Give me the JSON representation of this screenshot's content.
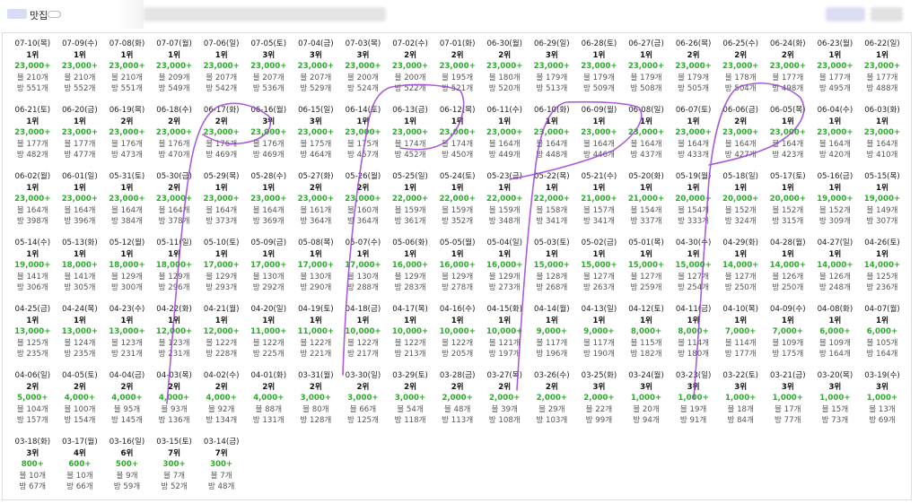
{
  "header": {
    "title": "맛집"
  },
  "rows": [
    [
      {
        "date": "07-10(목)",
        "rank": "1위",
        "price": "23,000+",
        "posts": "블 210개",
        "views": "방 551개"
      },
      {
        "date": "07-09(수)",
        "rank": "1위",
        "price": "23,000+",
        "posts": "블 210개",
        "views": "방 552개"
      },
      {
        "date": "07-08(화)",
        "rank": "1위",
        "price": "23,000+",
        "posts": "블 210개",
        "views": "방 551개"
      },
      {
        "date": "07-07(월)",
        "rank": "1위",
        "price": "23,000+",
        "posts": "블 209개",
        "views": "방 549개"
      },
      {
        "date": "07-06(일)",
        "rank": "1위",
        "price": "23,000+",
        "posts": "블 207개",
        "views": "방 542개"
      },
      {
        "date": "07-05(토)",
        "rank": "3위",
        "price": "23,000+",
        "posts": "블 207개",
        "views": "방 536개"
      },
      {
        "date": "07-04(금)",
        "rank": "3위",
        "price": "23,000+",
        "posts": "블 207개",
        "views": "방 529개"
      },
      {
        "date": "07-03(목)",
        "rank": "3위",
        "price": "23,000+",
        "posts": "블 200개",
        "views": "방 524개"
      },
      {
        "date": "07-02(수)",
        "rank": "2위",
        "price": "23,000+",
        "posts": "블 200개",
        "views": "방 522개"
      },
      {
        "date": "07-01(화)",
        "rank": "2위",
        "price": "23,000+",
        "posts": "블 195개",
        "views": "방 521개"
      },
      {
        "date": "06-30(월)",
        "rank": "2위",
        "price": "23,000+",
        "posts": "블 180개",
        "views": "방 520개"
      },
      {
        "date": "06-29(일)",
        "rank": "3위",
        "price": "23,000+",
        "posts": "블 179개",
        "views": "방 513개"
      },
      {
        "date": "06-28(토)",
        "rank": "1위",
        "price": "23,000+",
        "posts": "블 179개",
        "views": "방 509개"
      },
      {
        "date": "06-27(금)",
        "rank": "1위",
        "price": "23,000+",
        "posts": "블 179개",
        "views": "방 508개"
      },
      {
        "date": "06-26(목)",
        "rank": "2위",
        "price": "23,000+",
        "posts": "블 179개",
        "views": "방 505개"
      },
      {
        "date": "06-25(수)",
        "rank": "2위",
        "price": "23,000+",
        "posts": "블 178개",
        "views": "방 504개"
      },
      {
        "date": "06-24(화)",
        "rank": "2위",
        "price": "23,000+",
        "posts": "블 177개",
        "views": "방 498개"
      },
      {
        "date": "06-23(월)",
        "rank": "1위",
        "price": "23,000+",
        "posts": "블 177개",
        "views": "방 495개"
      },
      {
        "date": "06-22(일)",
        "rank": "1위",
        "price": "23,000+",
        "posts": "블 177개",
        "views": "방 488개"
      }
    ],
    [
      {
        "date": "06-21(토)",
        "rank": "1위",
        "price": "23,000+",
        "posts": "블 177개",
        "views": "방 482개"
      },
      {
        "date": "06-20(금)",
        "rank": "1위",
        "price": "23,000+",
        "posts": "블 177개",
        "views": "방 477개"
      },
      {
        "date": "06-19(목)",
        "rank": "2위",
        "price": "23,000+",
        "posts": "블 176개",
        "views": "방 473개"
      },
      {
        "date": "06-18(수)",
        "rank": "2위",
        "price": "23,000+",
        "posts": "블 176개",
        "views": "방 470개"
      },
      {
        "date": "06-17(화)",
        "rank": "2위",
        "price": "23,000+",
        "posts": "블 176개",
        "views": "방 469개"
      },
      {
        "date": "06-16(월)",
        "rank": "3위",
        "price": "23,000+",
        "posts": "블 176개",
        "views": "방 469개"
      },
      {
        "date": "06-15(일)",
        "rank": "3위",
        "price": "23,000+",
        "posts": "블 175개",
        "views": "방 464개"
      },
      {
        "date": "06-14(토)",
        "rank": "1위",
        "price": "23,000+",
        "posts": "블 175개",
        "views": "방 457개"
      },
      {
        "date": "06-13(금)",
        "rank": "1위",
        "price": "23,000+",
        "posts": "블 174개",
        "views": "방 452개"
      },
      {
        "date": "06-12(목)",
        "rank": "1위",
        "price": "23,000+",
        "posts": "블 174개",
        "views": "방 450개"
      },
      {
        "date": "06-11(수)",
        "rank": "1위",
        "price": "23,000+",
        "posts": "블 164개",
        "views": "방 449개"
      },
      {
        "date": "06-10(화)",
        "rank": "1위",
        "price": "23,000+",
        "posts": "블 164개",
        "views": "방 448개"
      },
      {
        "date": "06-09(월)",
        "rank": "1위",
        "price": "23,000+",
        "posts": "블 164개",
        "views": "방 446개"
      },
      {
        "date": "06-08(일)",
        "rank": "1위",
        "price": "23,000+",
        "posts": "블 164개",
        "views": "방 437개"
      },
      {
        "date": "06-07(토)",
        "rank": "1위",
        "price": "23,000+",
        "posts": "블 164개",
        "views": "방 433개"
      },
      {
        "date": "06-06(금)",
        "rank": "2위",
        "price": "23,000+",
        "posts": "블 164개",
        "views": "방 427개"
      },
      {
        "date": "06-05(목)",
        "rank": "1위",
        "price": "23,000+",
        "posts": "블 164개",
        "views": "방 423개"
      },
      {
        "date": "06-04(수)",
        "rank": "1위",
        "price": "23,000+",
        "posts": "블 164개",
        "views": "방 420개"
      },
      {
        "date": "06-03(화)",
        "rank": "1위",
        "price": "23,000+",
        "posts": "블 164개",
        "views": "방 410개"
      }
    ],
    [
      {
        "date": "06-02(월)",
        "rank": "1위",
        "price": "23,000+",
        "posts": "블 164개",
        "views": "방 398개"
      },
      {
        "date": "06-01(일)",
        "rank": "1위",
        "price": "23,000+",
        "posts": "블 164개",
        "views": "방 396개"
      },
      {
        "date": "05-31(토)",
        "rank": "1위",
        "price": "23,000+",
        "posts": "블 164개",
        "views": "방 384개"
      },
      {
        "date": "05-30(금)",
        "rank": "2위",
        "price": "23,000+",
        "posts": "블 164개",
        "views": "방 378개"
      },
      {
        "date": "05-29(목)",
        "rank": "1위",
        "price": "23,000+",
        "posts": "블 164개",
        "views": "방 373개"
      },
      {
        "date": "05-28(수)",
        "rank": "1위",
        "price": "23,000+",
        "posts": "블 164개",
        "views": "방 369개"
      },
      {
        "date": "05-27(화)",
        "rank": "2위",
        "price": "23,000+",
        "posts": "블 161개",
        "views": "방 364개"
      },
      {
        "date": "05-26(월)",
        "rank": "2위",
        "price": "23,000+",
        "posts": "블 160개",
        "views": "방 364개"
      },
      {
        "date": "05-25(일)",
        "rank": "1위",
        "price": "22,000+",
        "posts": "블 159개",
        "views": "방 361개"
      },
      {
        "date": "05-24(토)",
        "rank": "1위",
        "price": "22,000+",
        "posts": "블 159개",
        "views": "방 352개"
      },
      {
        "date": "05-23(금)",
        "rank": "1위",
        "price": "22,000+",
        "posts": "블 159개",
        "views": "방 348개"
      },
      {
        "date": "05-22(목)",
        "rank": "1위",
        "price": "22,000+",
        "posts": "블 158개",
        "views": "방 341개"
      },
      {
        "date": "05-21(수)",
        "rank": "1위",
        "price": "21,000+",
        "posts": "블 157개",
        "views": "방 341개"
      },
      {
        "date": "05-20(화)",
        "rank": "1위",
        "price": "21,000+",
        "posts": "블 154개",
        "views": "방 337개"
      },
      {
        "date": "05-19(월)",
        "rank": "1위",
        "price": "20,000+",
        "posts": "블 154개",
        "views": "방 333개"
      },
      {
        "date": "05-18(일)",
        "rank": "1위",
        "price": "20,000+",
        "posts": "블 152개",
        "views": "방 324개"
      },
      {
        "date": "05-17(토)",
        "rank": "1위",
        "price": "20,000+",
        "posts": "블 152개",
        "views": "방 315개"
      },
      {
        "date": "05-16(금)",
        "rank": "1위",
        "price": "19,000+",
        "posts": "블 152개",
        "views": "방 309개"
      },
      {
        "date": "05-15(목)",
        "rank": "1위",
        "price": "19,000+",
        "posts": "블 149개",
        "views": "방 307개"
      }
    ],
    [
      {
        "date": "05-14(수)",
        "rank": "1위",
        "price": "19,000+",
        "posts": "블 141개",
        "views": "방 306개"
      },
      {
        "date": "05-13(화)",
        "rank": "1위",
        "price": "18,000+",
        "posts": "블 141개",
        "views": "방 305개"
      },
      {
        "date": "05-12(월)",
        "rank": "1위",
        "price": "18,000+",
        "posts": "블 129개",
        "views": "방 300개"
      },
      {
        "date": "05-11(일)",
        "rank": "1위",
        "price": "18,000+",
        "posts": "블 129개",
        "views": "방 296개"
      },
      {
        "date": "05-10(토)",
        "rank": "1위",
        "price": "17,000+",
        "posts": "블 129개",
        "views": "방 293개"
      },
      {
        "date": "05-09(금)",
        "rank": "1위",
        "price": "17,000+",
        "posts": "블 130개",
        "views": "방 292개"
      },
      {
        "date": "05-08(목)",
        "rank": "1위",
        "price": "17,000+",
        "posts": "블 130개",
        "views": "방 290개"
      },
      {
        "date": "05-07(수)",
        "rank": "1위",
        "price": "17,000+",
        "posts": "블 130개",
        "views": "방 288개"
      },
      {
        "date": "05-06(화)",
        "rank": "1위",
        "price": "16,000+",
        "posts": "블 129개",
        "views": "방 283개"
      },
      {
        "date": "05-05(월)",
        "rank": "1위",
        "price": "16,000+",
        "posts": "블 129개",
        "views": "방 278개"
      },
      {
        "date": "05-04(일)",
        "rank": "1위",
        "price": "16,000+",
        "posts": "블 129개",
        "views": "방 273개"
      },
      {
        "date": "05-03(토)",
        "rank": "1위",
        "price": "15,000+",
        "posts": "블 128개",
        "views": "방 268개"
      },
      {
        "date": "05-02(금)",
        "rank": "1위",
        "price": "15,000+",
        "posts": "블 127개",
        "views": "방 263개"
      },
      {
        "date": "05-01(목)",
        "rank": "1위",
        "price": "15,000+",
        "posts": "블 127개",
        "views": "방 259개"
      },
      {
        "date": "04-30(수)",
        "rank": "1위",
        "price": "15,000+",
        "posts": "블 127개",
        "views": "방 254개"
      },
      {
        "date": "04-29(화)",
        "rank": "1위",
        "price": "14,000+",
        "posts": "블 127개",
        "views": "방 250개"
      },
      {
        "date": "04-28(월)",
        "rank": "1위",
        "price": "14,000+",
        "posts": "블 126개",
        "views": "방 250개"
      },
      {
        "date": "04-27(일)",
        "rank": "1위",
        "price": "14,000+",
        "posts": "블 126개",
        "views": "방 248개"
      },
      {
        "date": "04-26(토)",
        "rank": "1위",
        "price": "14,000+",
        "posts": "블 125개",
        "views": "방 236개"
      }
    ],
    [
      {
        "date": "04-25(금)",
        "rank": "1위",
        "price": "13,000+",
        "posts": "블 125개",
        "views": "방 235개"
      },
      {
        "date": "04-24(목)",
        "rank": "1위",
        "price": "13,000+",
        "posts": "블 124개",
        "views": "방 235개"
      },
      {
        "date": "04-23(수)",
        "rank": "1위",
        "price": "13,000+",
        "posts": "블 123개",
        "views": "방 231개"
      },
      {
        "date": "04-22(화)",
        "rank": "1위",
        "price": "12,000+",
        "posts": "블 123개",
        "views": "방 231개"
      },
      {
        "date": "04-21(월)",
        "rank": "1위",
        "price": "12,000+",
        "posts": "블 122개",
        "views": "방 228개"
      },
      {
        "date": "04-20(일)",
        "rank": "1위",
        "price": "11,000+",
        "posts": "블 122개",
        "views": "방 225개"
      },
      {
        "date": "04-19(토)",
        "rank": "1위",
        "price": "11,000+",
        "posts": "블 122개",
        "views": "방 221개"
      },
      {
        "date": "04-18(금)",
        "rank": "1위",
        "price": "10,000+",
        "posts": "블 122개",
        "views": "방 217개"
      },
      {
        "date": "04-17(목)",
        "rank": "1위",
        "price": "10,000+",
        "posts": "블 122개",
        "views": "방 213개"
      },
      {
        "date": "04-16(수)",
        "rank": "1위",
        "price": "10,000+",
        "posts": "블 122개",
        "views": "방 205개"
      },
      {
        "date": "04-15(화)",
        "rank": "1위",
        "price": "10,000+",
        "posts": "블 121개",
        "views": "방 197개"
      },
      {
        "date": "04-14(월)",
        "rank": "1위",
        "price": "9,000+",
        "posts": "블 117개",
        "views": "방 196개"
      },
      {
        "date": "04-13(일)",
        "rank": "1위",
        "price": "9,000+",
        "posts": "블 117개",
        "views": "방 190개"
      },
      {
        "date": "04-12(토)",
        "rank": "1위",
        "price": "8,000+",
        "posts": "블 115개",
        "views": "방 182개"
      },
      {
        "date": "04-11(금)",
        "rank": "1위",
        "price": "8,000+",
        "posts": "블 114개",
        "views": "방 180개"
      },
      {
        "date": "04-10(목)",
        "rank": "1위",
        "price": "7,000+",
        "posts": "블 114개",
        "views": "방 177개"
      },
      {
        "date": "04-09(수)",
        "rank": "1위",
        "price": "7,000+",
        "posts": "블 109개",
        "views": "방 175개"
      },
      {
        "date": "04-08(화)",
        "rank": "1위",
        "price": "6,000+",
        "posts": "블 109개",
        "views": "방 164개"
      },
      {
        "date": "04-07(월)",
        "rank": "1위",
        "price": "6,000+",
        "posts": "블 105개",
        "views": "방 164개"
      }
    ],
    [
      {
        "date": "04-06(일)",
        "rank": "2위",
        "price": "5,000+",
        "posts": "블 104개",
        "views": "방 157개"
      },
      {
        "date": "04-05(토)",
        "rank": "2위",
        "price": "4,000+",
        "posts": "블 100개",
        "views": "방 154개"
      },
      {
        "date": "04-04(금)",
        "rank": "2위",
        "price": "4,000+",
        "posts": "블 95개",
        "views": "방 145개"
      },
      {
        "date": "04-03(목)",
        "rank": "2위",
        "price": "4,000+",
        "posts": "블 93개",
        "views": "방 136개"
      },
      {
        "date": "04-02(수)",
        "rank": "2위",
        "price": "4,000+",
        "posts": "블 92개",
        "views": "방 134개"
      },
      {
        "date": "04-01(화)",
        "rank": "2위",
        "price": "4,000+",
        "posts": "블 88개",
        "views": "방 131개"
      },
      {
        "date": "03-31(월)",
        "rank": "2위",
        "price": "3,000+",
        "posts": "블 80개",
        "views": "방 128개"
      },
      {
        "date": "03-30(일)",
        "rank": "2위",
        "price": "3,000+",
        "posts": "블 66개",
        "views": "방 125개"
      },
      {
        "date": "03-29(토)",
        "rank": "2위",
        "price": "3,000+",
        "posts": "블 54개",
        "views": "방 118개"
      },
      {
        "date": "03-28(금)",
        "rank": "2위",
        "price": "2,000+",
        "posts": "블 48개",
        "views": "방 113개"
      },
      {
        "date": "03-27(목)",
        "rank": "2위",
        "price": "2,000+",
        "posts": "블 39개",
        "views": "방 108개"
      },
      {
        "date": "03-26(수)",
        "rank": "2위",
        "price": "2,000+",
        "posts": "블 29개",
        "views": "방 103개"
      },
      {
        "date": "03-25(화)",
        "rank": "3위",
        "price": "2,000+",
        "posts": "블 22개",
        "views": "방 99개"
      },
      {
        "date": "03-24(월)",
        "rank": "3위",
        "price": "1,000+",
        "posts": "블 20개",
        "views": "방 94개"
      },
      {
        "date": "03-23(일)",
        "rank": "3위",
        "price": "1,000+",
        "posts": "블 19개",
        "views": "방 91개"
      },
      {
        "date": "03-22(토)",
        "rank": "3위",
        "price": "1,000+",
        "posts": "블 18개",
        "views": "방 84개"
      },
      {
        "date": "03-21(금)",
        "rank": "3위",
        "price": "1,000+",
        "posts": "블 17개",
        "views": "방 77개"
      },
      {
        "date": "03-20(목)",
        "rank": "3위",
        "price": "1,000+",
        "posts": "블 15개",
        "views": "방 73개"
      },
      {
        "date": "03-19(수)",
        "rank": "3위",
        "price": "1,000+",
        "posts": "블 13개",
        "views": "방 69개"
      }
    ],
    [
      {
        "date": "03-18(화)",
        "rank": "3위",
        "price": "800+",
        "posts": "블 10개",
        "views": "방 67개"
      },
      {
        "date": "03-17(월)",
        "rank": "4위",
        "price": "600+",
        "posts": "블 10개",
        "views": "방 66개"
      },
      {
        "date": "03-16(일)",
        "rank": "6위",
        "price": "500+",
        "posts": "블 9개",
        "views": "방 59개"
      },
      {
        "date": "03-15(토)",
        "rank": "7위",
        "price": "300+",
        "posts": "블 7개",
        "views": "방 52개"
      },
      {
        "date": "03-14(금)",
        "rank": "7위",
        "price": "300+",
        "posts": "블 7개",
        "views": "방 48개"
      }
    ]
  ],
  "colors": {
    "price": "#2eaa2e",
    "annotation": "#9b3fd6"
  }
}
